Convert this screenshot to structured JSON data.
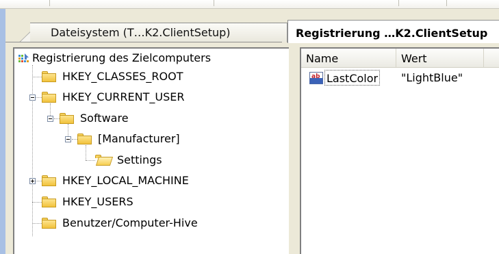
{
  "tabs": {
    "inactive_label": "Dateisystem (T…K2.ClientSetup)",
    "active_label": "Registrierung …K2.ClientSetup"
  },
  "tree": {
    "root_label": "Registrierung des Zielcomputers",
    "nodes": [
      {
        "label": "HKEY_CLASSES_ROOT"
      },
      {
        "label": "HKEY_CURRENT_USER"
      },
      {
        "label": "Software"
      },
      {
        "label": "[Manufacturer]"
      },
      {
        "label": "Settings"
      },
      {
        "label": "HKEY_LOCAL_MACHINE"
      },
      {
        "label": "HKEY_USERS"
      },
      {
        "label": "Benutzer/Computer-Hive"
      }
    ]
  },
  "list": {
    "columns": [
      {
        "label": "Name"
      },
      {
        "label": "Wert"
      }
    ],
    "rows": [
      {
        "name": "LastColor",
        "value": "\"LightBlue\""
      }
    ]
  },
  "icons": {
    "root": "registry-computer-icon",
    "folder": "folder-icon",
    "open_folder": "folder-open-icon",
    "string_value": "string-value-icon"
  }
}
